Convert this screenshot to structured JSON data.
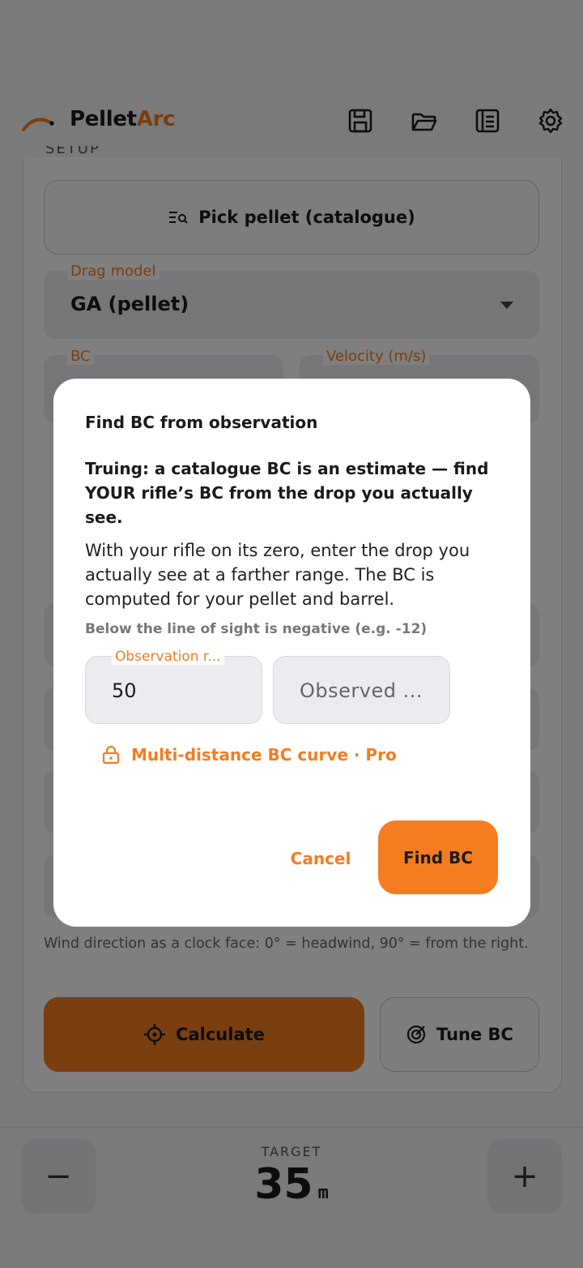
{
  "header": {
    "title_main": "Pellet",
    "title_accent": "Arc",
    "icons": [
      "save-icon",
      "folder-open-icon",
      "notebook-icon",
      "gear-icon"
    ]
  },
  "form": {
    "section_label_cut": "SETUP",
    "pick_pellet_label": "Pick pellet (catalogue)",
    "drag_model_label": "Drag model",
    "drag_model_value": "GA (pellet)",
    "bc_label": "BC",
    "velocity_label": "Velocity (m/s)",
    "wind_help": "Wind direction as a clock face: 0° = headwind, 90° = from the right.",
    "calculate_label": "Calculate",
    "tune_bc_label": "Tune BC"
  },
  "bottom": {
    "target_label": "TARGET",
    "target_value": "35",
    "target_unit": "m",
    "minus_label": "−",
    "plus_label": "+"
  },
  "dialog": {
    "title": "Find BC from observation",
    "bold_text": "Truing: a catalogue BC is an estimate — find YOUR rifle’s BC from the drop you actually see.",
    "body_text": "With your rifle on its zero, enter the drop you actually see at a farther range. The BC is computed for your pellet and barrel.",
    "hint": "Below the line of sight is negative (e.g. -12)",
    "range_label": "Observation r...",
    "range_value": "50",
    "drop_placeholder": "Observed ...",
    "pro_label": "Multi-distance BC curve · Pro",
    "cancel_label": "Cancel",
    "find_label": "Find BC"
  },
  "colors": {
    "accent": "#f57c1f",
    "scrim": "rgba(0,0,0,0.5)"
  }
}
